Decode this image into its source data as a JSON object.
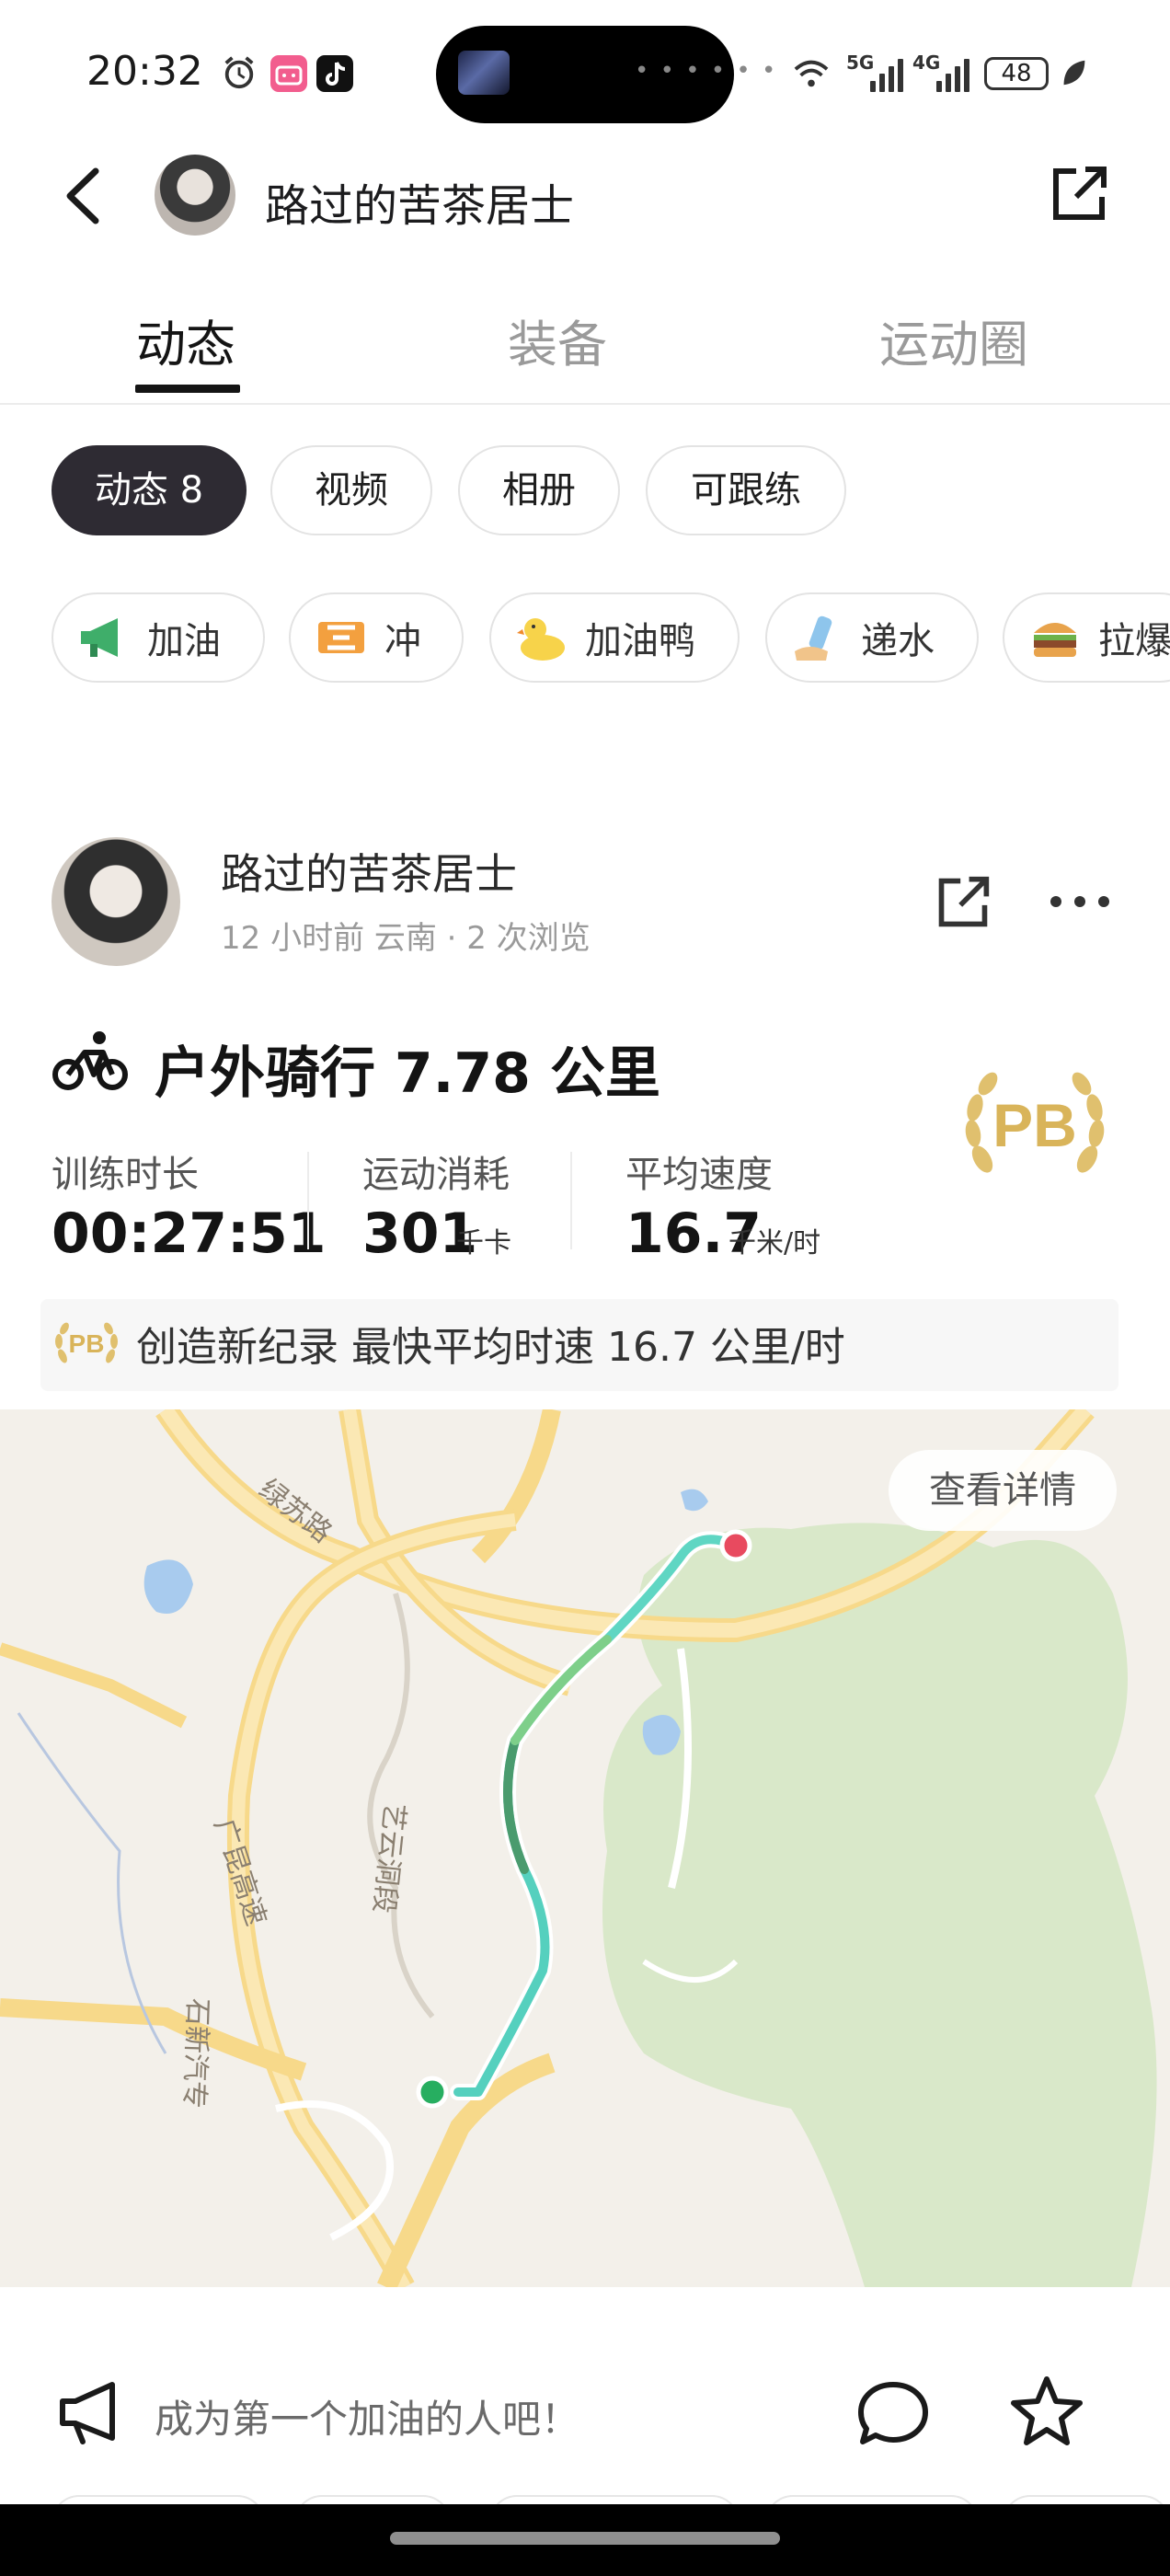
{
  "status_bar": {
    "time": "20:32",
    "battery": "48",
    "network_1": "5G",
    "network_2": "4G"
  },
  "header": {
    "username": "路过的苦茶居士"
  },
  "tabs": [
    {
      "label": "动态",
      "active": true
    },
    {
      "label": "装备",
      "active": false
    },
    {
      "label": "运动圈",
      "active": false
    }
  ],
  "filters": [
    {
      "label": "动态 8",
      "active": true
    },
    {
      "label": "视频",
      "active": false
    },
    {
      "label": "相册",
      "active": false
    },
    {
      "label": "可跟练",
      "active": false
    }
  ],
  "reactions": [
    {
      "label": "加油",
      "icon": "megaphone-icon"
    },
    {
      "label": "冲",
      "icon": "dash-icon"
    },
    {
      "label": "加油鸭",
      "icon": "duck-icon"
    },
    {
      "label": "递水",
      "icon": "water-bottle-icon"
    },
    {
      "label": "拉爆",
      "icon": "burger-icon"
    }
  ],
  "post": {
    "username": "路过的苦茶居士",
    "meta": "12 小时前 云南 · 2 次浏览",
    "activity_title": "户外骑行 7.78 公里",
    "badge": "PB",
    "stats": [
      {
        "label": "训练时长",
        "value": "00:27:51",
        "unit": ""
      },
      {
        "label": "运动消耗",
        "value": "301",
        "unit": "千卡"
      },
      {
        "label": "平均速度",
        "value": "16.7",
        "unit": "千米/时"
      }
    ],
    "record": "创造新纪录 最快平均时速 16.7 公里/时",
    "map": {
      "detail_button": "查看详情",
      "labels": [
        "绿苏路",
        "广昆高速",
        "艺云洞段",
        "石新汽专"
      ]
    }
  },
  "footer": {
    "cheer_prompt": "成为第一个加油的人吧！"
  },
  "colors": {
    "accent_dark": "#2e2b33",
    "route_start": "#27ae60",
    "route_end": "#e84a5f",
    "pb_gold": "#d9b45a"
  }
}
